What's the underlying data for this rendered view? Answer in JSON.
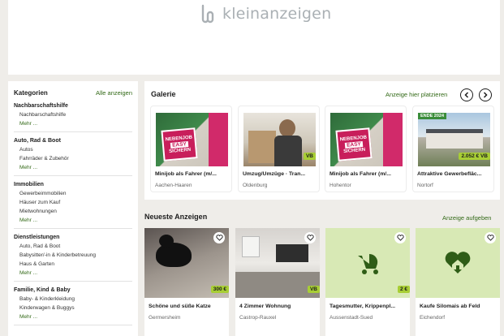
{
  "header": {
    "logo_text": "kleinanzeigen"
  },
  "sidebar": {
    "title": "Kategorien",
    "all_link": "Alle anzeigen",
    "categories": [
      {
        "title": "Nachbarschaftshilfe",
        "subs": [
          "Nachbarschaftshilfe"
        ],
        "more": "Mehr ..."
      },
      {
        "title": "Auto, Rad & Boot",
        "subs": [
          "Autos",
          "Fahrräder & Zubehör"
        ],
        "more": "Mehr ..."
      },
      {
        "title": "Immobilien",
        "subs": [
          "Gewerbeimmobilien",
          "Häuser zum Kauf",
          "Mietwohnungen"
        ],
        "more": "Mehr ..."
      },
      {
        "title": "Dienstleistungen",
        "subs": [
          "Auto, Rad & Boot",
          "Babysitter/-in & Kinderbetreuung",
          "Haus & Garten"
        ],
        "more": "Mehr ..."
      },
      {
        "title": "Familie, Kind & Baby",
        "subs": [
          "Baby- & Kinderkleidung",
          "Kinderwagen & Buggys"
        ],
        "more": "Mehr ..."
      }
    ]
  },
  "gallery": {
    "title": "Galerie",
    "place_link": "Anzeige hier platzieren",
    "prev_icon": "chevron-left-icon",
    "next_icon": "chevron-right-icon",
    "items": [
      {
        "title": "Minijob als Fahrer (m/...",
        "location": "Aachen-Haaren",
        "badge_line1": "NEBENJOB",
        "badge_line2": "EASY",
        "badge_line3": "SICHERN",
        "price": ""
      },
      {
        "title": "Umzug/Umzüge · Tran...",
        "location": "Oldenburg",
        "price": "VB"
      },
      {
        "title": "Minijob als Fahrer (m/...",
        "location": "Hohentor",
        "badge_line1": "NEBENJOB",
        "badge_line2": "EASY",
        "badge_line3": "SICHERN",
        "price": ""
      },
      {
        "title": "Attraktive Gewerbefläc...",
        "location": "Nortorf",
        "price": "2.052 € VB",
        "ribbon": "ENDE 2024"
      }
    ]
  },
  "newest": {
    "title": "Neueste Anzeigen",
    "post_link": "Anzeige aufgeben",
    "items": [
      {
        "title": "Schöne und süße Katze",
        "location": "Germersheim",
        "price": "300 €"
      },
      {
        "title": "4 Zimmer Wohnung",
        "location": "Castrop-Rauxel",
        "price": "VB"
      },
      {
        "title": "Tagesmutter, Krippenpl...",
        "location": "Aussenstadt-Sued",
        "price": "2 €",
        "icon": "stroller-icon"
      },
      {
        "title": "Kaufe Silomais ab Feld",
        "location": "Eichendorf",
        "price": "",
        "icon": "heart-house-icon"
      }
    ]
  },
  "colors": {
    "brand_green": "#326916",
    "price_green": "#a8ce35",
    "page_bg": "#efede9"
  }
}
